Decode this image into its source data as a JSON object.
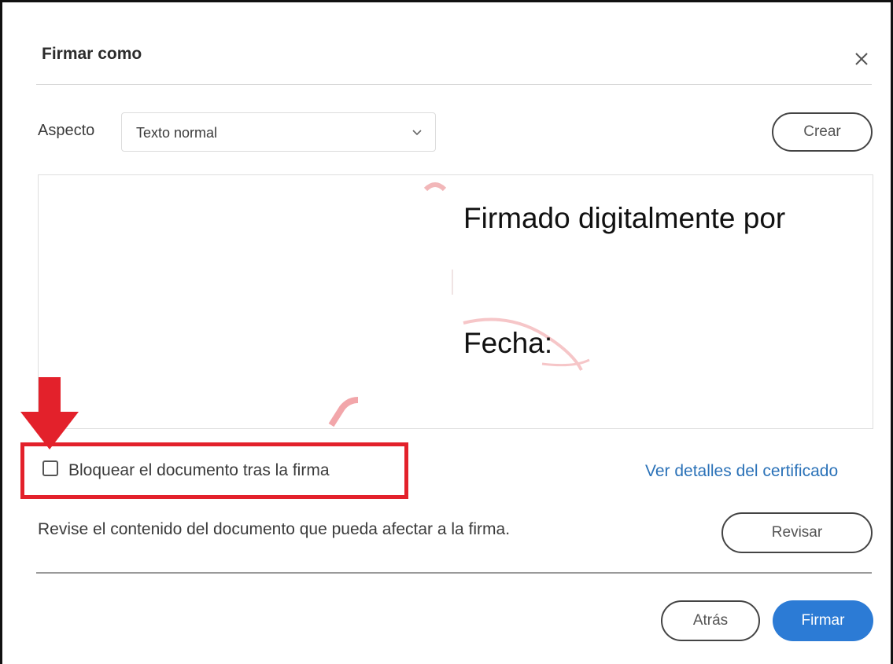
{
  "dialog": {
    "title": "Firmar como",
    "close_icon": "close-icon"
  },
  "appearance": {
    "label": "Aspecto",
    "selected": "Texto normal",
    "create_label": "Crear"
  },
  "preview": {
    "line1": "Firmado digitalmente por",
    "line2": "Fecha:"
  },
  "lock": {
    "label": "Bloquear el documento tras la firma",
    "checked": false
  },
  "certificate_link": "Ver detalles del certificado",
  "review": {
    "text": "Revise el contenido del documento que pueda afectar a la firma.",
    "button_label": "Revisar"
  },
  "footer": {
    "back_label": "Atrás",
    "sign_label": "Firmar"
  },
  "colors": {
    "annotation_red": "#e3212b",
    "primary_blue": "#2c7bd5",
    "link_blue": "#2b72b8"
  }
}
